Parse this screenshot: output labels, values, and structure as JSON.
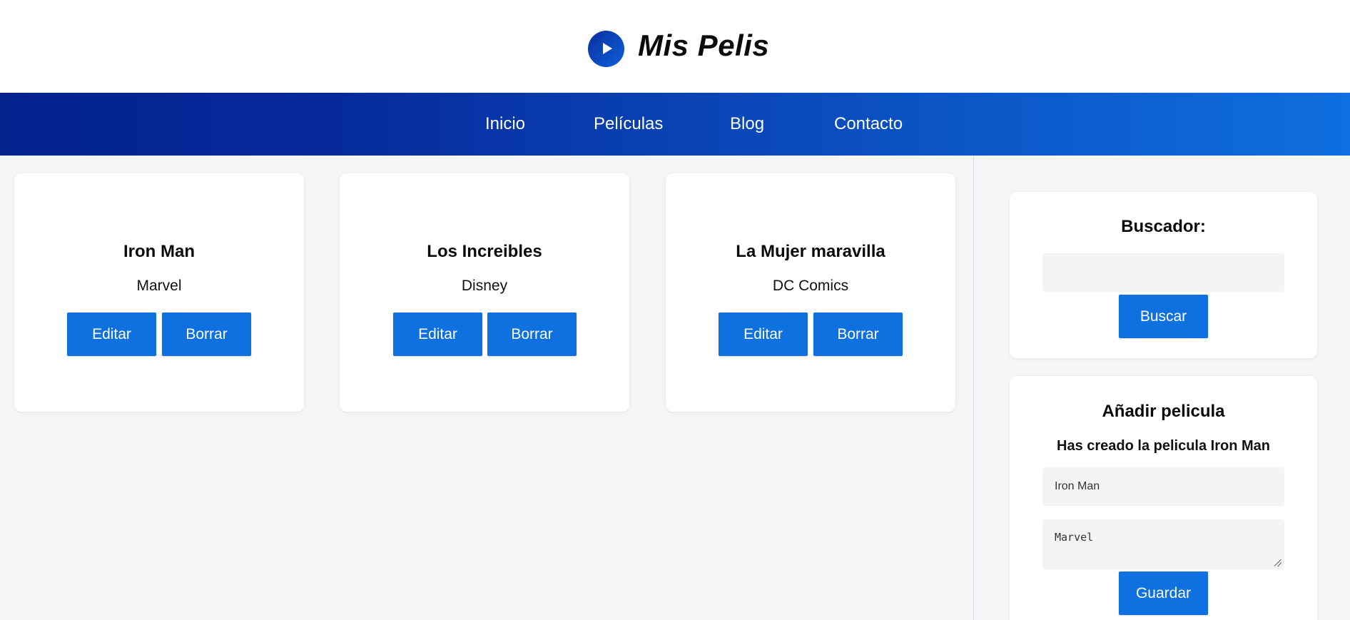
{
  "header": {
    "brand": "Mis Pelis",
    "logo_icon": "play-icon"
  },
  "nav": {
    "items": [
      {
        "label": "Inicio"
      },
      {
        "label": "Películas"
      },
      {
        "label": "Blog"
      },
      {
        "label": "Contacto"
      }
    ]
  },
  "movies": [
    {
      "title": "Iron Man",
      "studio": "Marvel",
      "edit_label": "Editar",
      "delete_label": "Borrar"
    },
    {
      "title": "Los Increibles",
      "studio": "Disney",
      "edit_label": "Editar",
      "delete_label": "Borrar"
    },
    {
      "title": "La Mujer maravilla",
      "studio": "DC Comics",
      "edit_label": "Editar",
      "delete_label": "Borrar"
    }
  ],
  "search": {
    "title": "Buscador:",
    "value": "",
    "button_label": "Buscar"
  },
  "add_movie": {
    "title": "Añadir pelicula",
    "message": "Has creado la pelicula Iron Man",
    "title_value": "Iron Man",
    "description_value": "Marvel",
    "save_label": "Guardar"
  },
  "colors": {
    "accent": "#0f70e0",
    "nav_start": "#04218e",
    "nav_end": "#0f6fe0",
    "background": "#f4f5f7"
  }
}
